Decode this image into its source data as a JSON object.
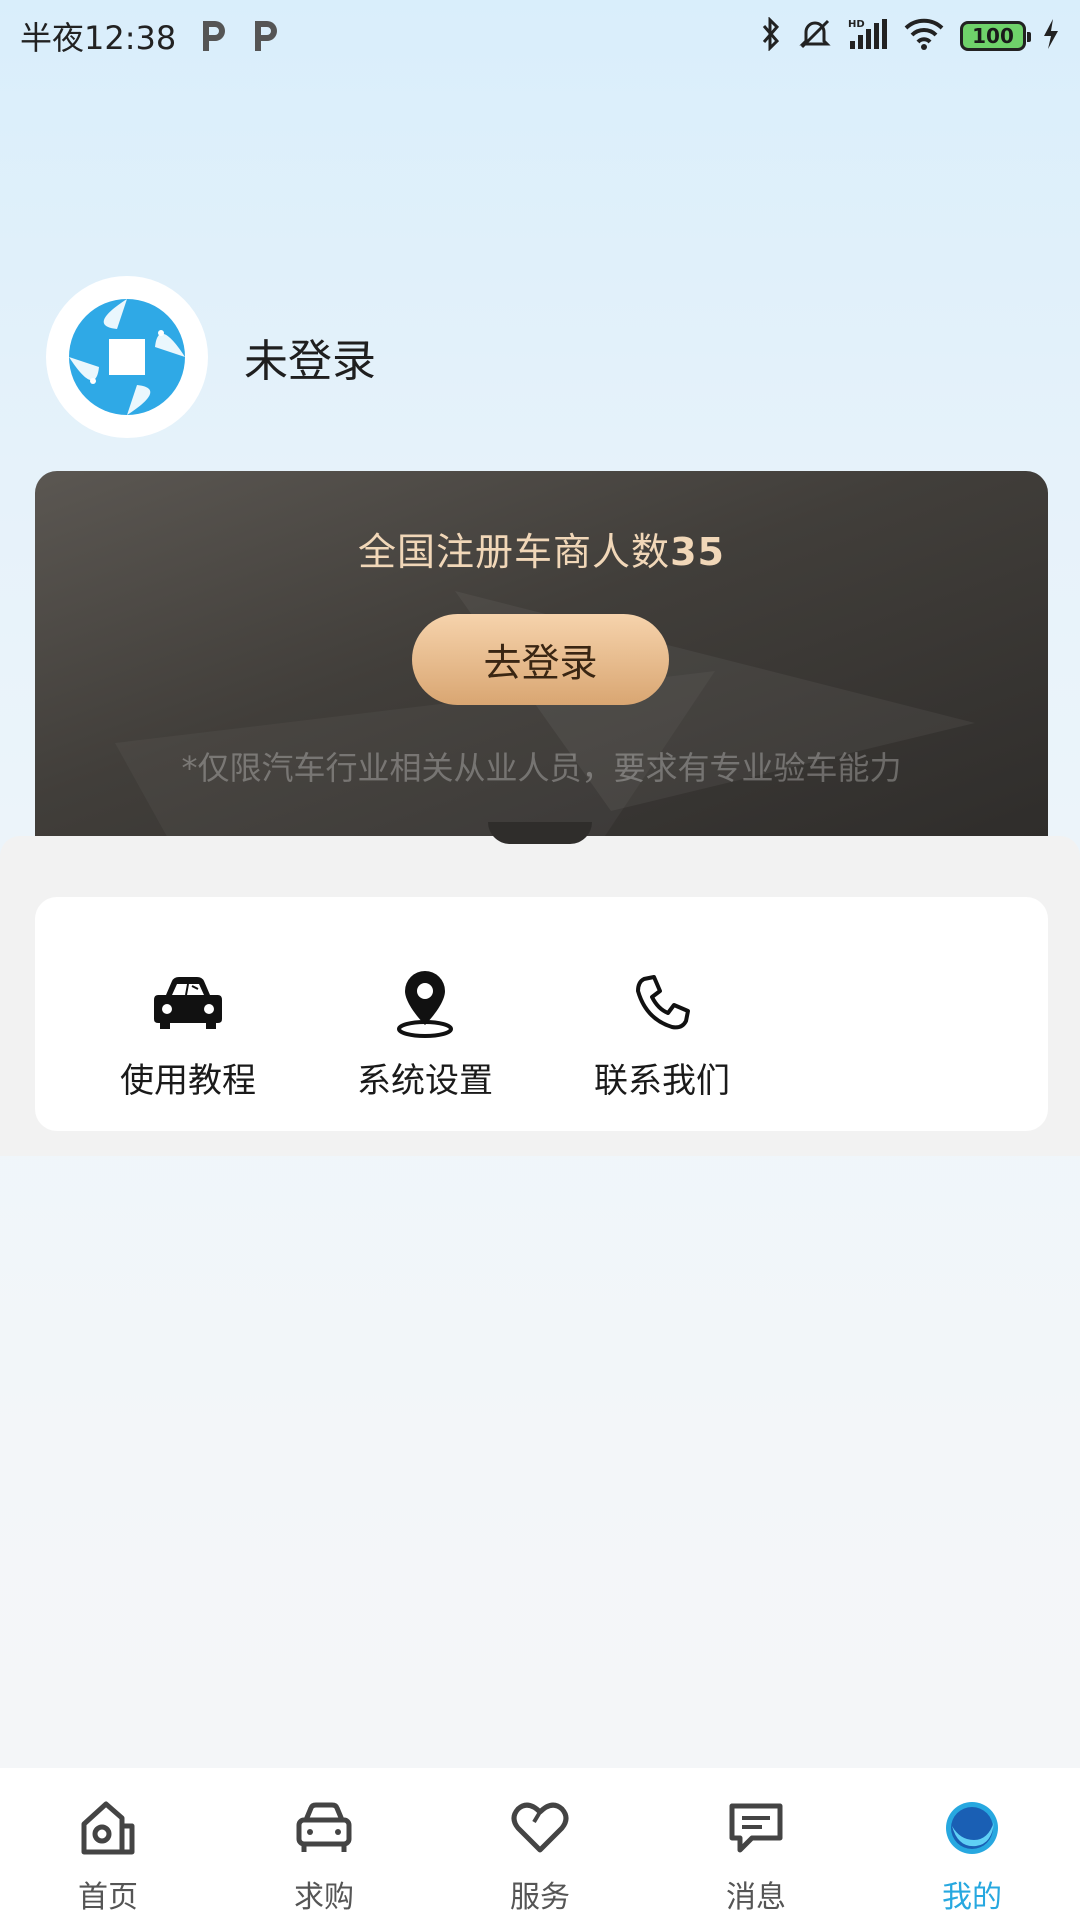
{
  "status_bar": {
    "time": "半夜12:38",
    "battery": "100"
  },
  "profile": {
    "name": "未登录"
  },
  "login_card": {
    "title_prefix": "全国注册车商人数",
    "count": "35",
    "button_label": "去登录",
    "note": "*仅限汽车行业相关从业人员，要求有专业验车能力"
  },
  "menu": {
    "items": [
      {
        "label": "使用教程",
        "icon": "car-icon"
      },
      {
        "label": "系统设置",
        "icon": "location-pin-icon"
      },
      {
        "label": "联系我们",
        "icon": "phone-icon"
      }
    ]
  },
  "tabbar": {
    "tabs": [
      {
        "label": "首页",
        "icon": "home-icon"
      },
      {
        "label": "求购",
        "icon": "car-outline-icon"
      },
      {
        "label": "服务",
        "icon": "heart-icon"
      },
      {
        "label": "消息",
        "icon": "message-icon"
      },
      {
        "label": "我的",
        "icon": "profile-circle-icon"
      }
    ],
    "active_color": "#27a8e0",
    "inactive_color": "#555555"
  }
}
